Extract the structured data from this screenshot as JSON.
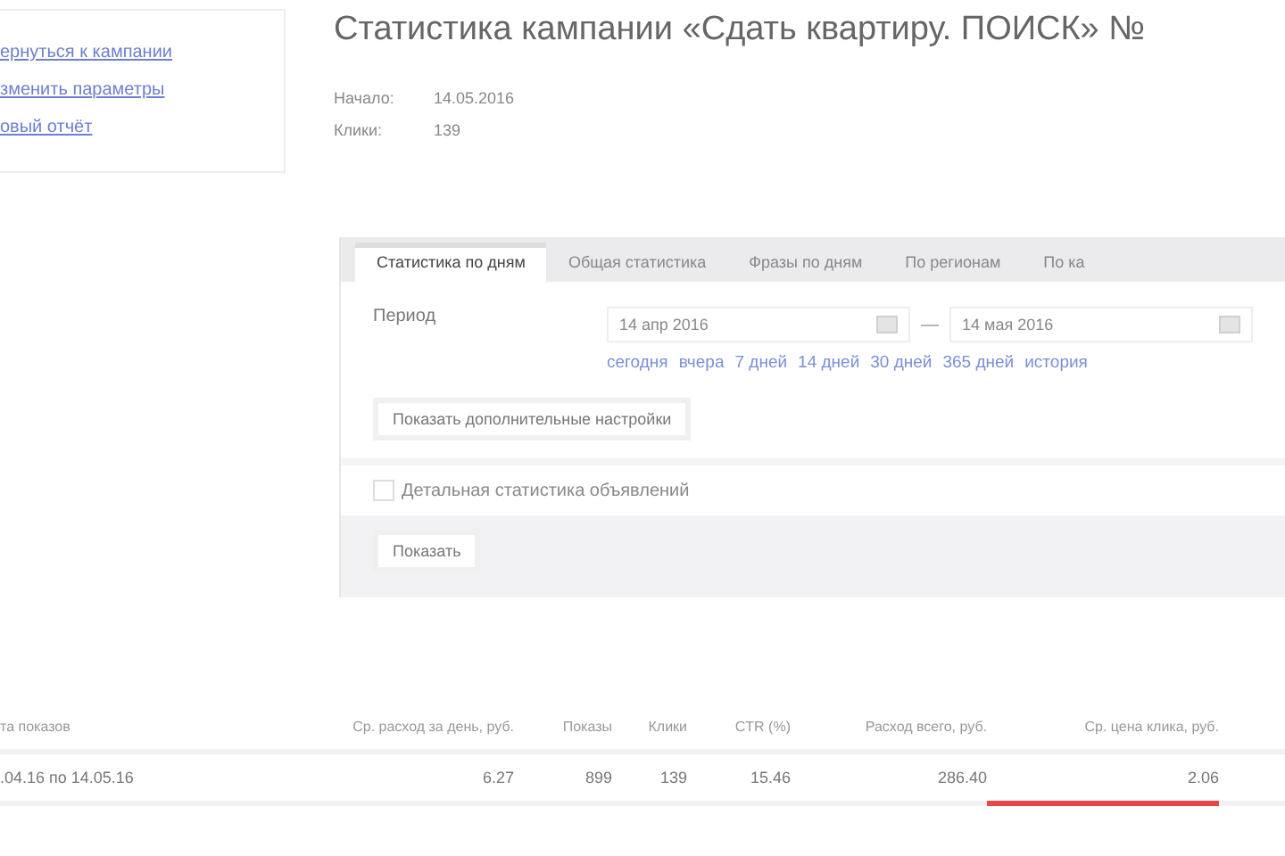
{
  "sidebar": {
    "links": [
      "ернуться к кампании",
      "зменить параметры",
      "овый отчёт"
    ]
  },
  "title": "Статистика кампании «Сдать квартиру. ПОИСК» №",
  "info": [
    {
      "label": "Начало:",
      "value": "14.05.2016"
    },
    {
      "label": "Клики:",
      "value": "139"
    }
  ],
  "tabs": [
    {
      "label": "Статистика по дням",
      "selected": true
    },
    {
      "label": "Общая статистика",
      "selected": false
    },
    {
      "label": "Фразы по дням",
      "selected": false
    },
    {
      "label": "По регионам",
      "selected": false
    },
    {
      "label": "По ка",
      "selected": false
    }
  ],
  "period": {
    "label": "Период",
    "from": "14 апр 2016",
    "separator": "—",
    "to": "14 мая 2016",
    "presets": [
      "сегодня",
      "вчера",
      "7 дней",
      "14 дней",
      "30 дней",
      "365 дней",
      "история"
    ]
  },
  "settings_button": "Показать дополнительные настройки",
  "detail_checkbox": {
    "label": "Детальная статистика объявлений",
    "checked": false
  },
  "show_button": "Показать",
  "table": {
    "columns": [
      "та показов",
      "Ср. расход за день, руб.",
      "Показы",
      "Клики",
      "CTR (%)",
      "Расход всего, руб.",
      "Ср. цена клика, руб."
    ],
    "rows": [
      [
        ".04.16 по 14.05.16",
        "6.27",
        "899",
        "139",
        "15.46",
        "286.40",
        "2.06"
      ]
    ]
  }
}
